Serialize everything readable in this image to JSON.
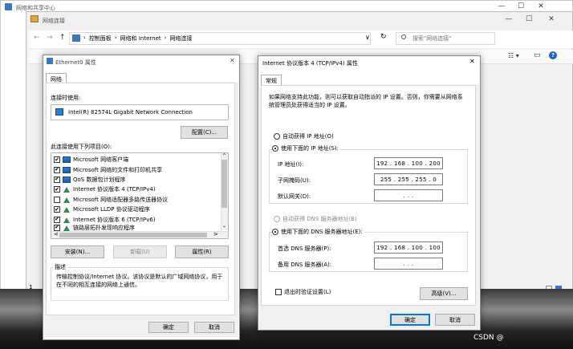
{
  "back_window": {
    "title": "网络和共享中心",
    "min": "—",
    "max": "☐",
    "close": "✕"
  },
  "front_window": {
    "title": "网络连接",
    "min": "—",
    "max": "☐",
    "close": "✕"
  },
  "explorer": {
    "nav": {
      "back": "←",
      "forward": "→",
      "up": "↑"
    },
    "breadcrumb": [
      "控制面板",
      "网络和 Internet",
      "网络连接"
    ],
    "breadcrumb_sep": "›",
    "dropdown": "∨",
    "refresh": "↻",
    "search_placeholder": "搜索\"网络连接\"",
    "cmd_icons": {
      "view": "☷ ▾",
      "pane": "▭",
      "help": "?"
    },
    "side_marker": "1"
  },
  "eth_dialog": {
    "title": "Ethernet0 属性",
    "close": "✕",
    "tab": "网络",
    "connect_using_label": "连接时使用:",
    "adapter": "Intel(R) 82574L Gigabit Network Connection",
    "configure_btn": "配置(C)...",
    "items_label": "此连接使用下列项目(O):",
    "items": [
      {
        "checked": "✔",
        "label": "Microsoft 网络客户端"
      },
      {
        "checked": "✔",
        "label": "Microsoft 网络的文件和打印机共享"
      },
      {
        "checked": "✔",
        "label": "QoS 数据包计划程序"
      },
      {
        "checked": "✔",
        "label": "Internet 协议版本 4 (TCP/IPv4)"
      },
      {
        "checked": "",
        "label": "Microsoft 网络适配器多路传送器协议"
      },
      {
        "checked": "✔",
        "label": "Microsoft LLDP 协议驱动程序"
      },
      {
        "checked": "✔",
        "label": "Internet 协议版本 6 (TCP/IPv6)"
      },
      {
        "checked": "✔",
        "label": "链路层拓扑发现响应程序"
      }
    ],
    "scroll_left": "<",
    "scroll_right": ">",
    "scroll_up": "^",
    "scroll_down": "⌄",
    "install_btn": "安装(N)...",
    "uninstall_btn": "卸载(U)",
    "properties_btn": "属性(R)",
    "desc_label": "描述",
    "desc_text": "传输控制协议/Internet 协议。该协议是默认的广域网络协议，用于在不同的相互连接的网络上通信。",
    "ok": "确定",
    "cancel": "取消"
  },
  "ipv4_dialog": {
    "title": "Internet 协议版本 4 (TCP/IPv4) 属性",
    "close": "✕",
    "tab": "常规",
    "intro": "如果网络支持此功能，则可以获取自动指派的 IP 设置。否则，你需要从网络系统管理员处获得适当的 IP 设置。",
    "auto_ip": "自动获得 IP 地址(O)",
    "manual_ip": "使用下面的 IP 地址(S):",
    "ip_label": "IP 地址(I):",
    "ip_value": "192 . 168 . 100 . 200",
    "mask_label": "子网掩码(U):",
    "mask_value": "255 . 255 . 255 . 0",
    "gw_label": "默认网关(D):",
    "gw_value": ".  .  .",
    "auto_dns": "自动获得 DNS 服务器地址(B)",
    "manual_dns": "使用下面的 DNS 服务器地址(E):",
    "dns1_label": "首选 DNS 服务器(P):",
    "dns1_value": "192 . 168 . 100 . 100",
    "dns2_label": "备用 DNS 服务器(A):",
    "dns2_value": ".  .  .",
    "validate": "退出时验证设置(L)",
    "advanced_btn": "高级(V)...",
    "ok": "确定",
    "cancel": "取消"
  },
  "watermark": "CSDN @"
}
